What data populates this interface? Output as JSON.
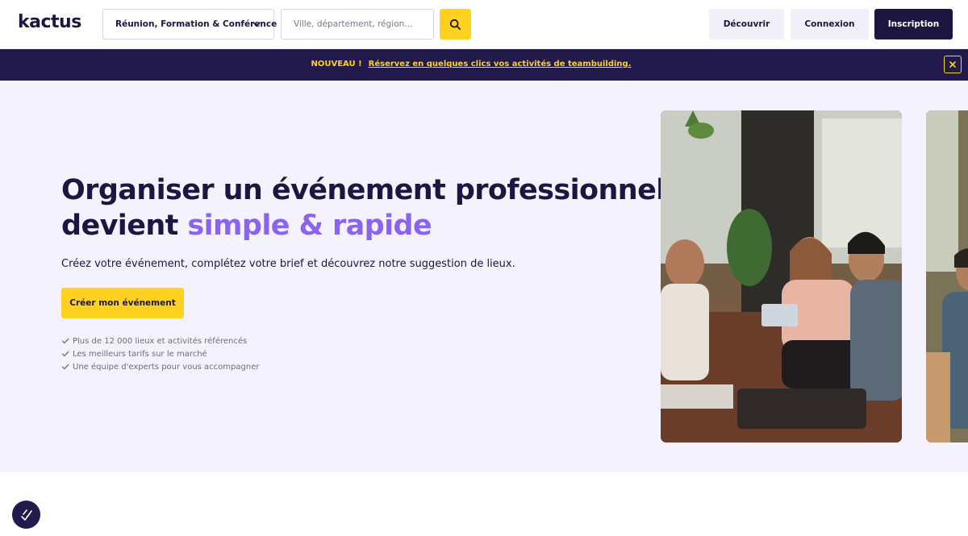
{
  "header": {
    "logo": "kactus",
    "event_type_select": "Réunion, Formation & Conférence",
    "location_placeholder": "Ville, département, région...",
    "nav": {
      "discover": "Découvrir",
      "login": "Connexion",
      "signup": "Inscription"
    }
  },
  "banner": {
    "badge": "NOUVEAU !",
    "link": "Réservez en quelques clics vos activités de teambuilding."
  },
  "hero": {
    "title_line1": "Organiser un événement professionnel",
    "title_line2_prefix": "devient ",
    "title_line2_accent": "simple & rapide",
    "subtitle": "Créez votre événement, complétez votre brief et découvrez notre suggestion de lieux.",
    "cta": "Créer mon événement",
    "features": [
      "Plus de 12 000 lieux et activités référencés",
      "Les meilleurs tarifs sur le marché",
      "Une équipe d'experts pour vous accompagner"
    ]
  },
  "colors": {
    "brand_dark": "#1c1640",
    "accent_yellow": "#ffd21f",
    "accent_purple": "#8a64ef",
    "hero_bg": "#f4f2fd",
    "banner_bg": "#211a4b"
  },
  "icons": {
    "select": "chevron-down-icon",
    "search": "search-icon",
    "close": "close-icon",
    "feature": "check-icon",
    "chat": "chat-icon"
  }
}
